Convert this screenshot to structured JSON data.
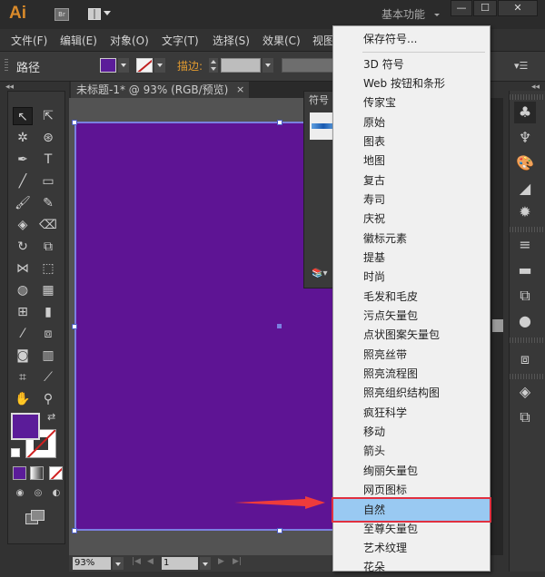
{
  "app": {
    "logo": "Ai",
    "bridge_label": "Br",
    "workspace": "基本功能",
    "window_buttons": {
      "minimize": "—",
      "maximize": "☐",
      "close": "✕"
    }
  },
  "menubar": [
    {
      "label": "文件(F)"
    },
    {
      "label": "编辑(E)"
    },
    {
      "label": "对象(O)"
    },
    {
      "label": "文字(T)"
    },
    {
      "label": "选择(S)"
    },
    {
      "label": "效果(C)"
    },
    {
      "label": "视图"
    }
  ],
  "control_bar": {
    "selection_label": "路径",
    "fill_color": "#5b1c99",
    "stroke_label": "描边:",
    "stroke_weight": "",
    "panel_menu_icon": "▾☰"
  },
  "document": {
    "tab_title": "未标题-1* @ 93% (RGB/预览)",
    "tab_close": "×",
    "artboard_color": "#5e1494",
    "zoom": "93%",
    "page": "1"
  },
  "symbols_panel": {
    "tab_label": "符号",
    "library_button": "lib"
  },
  "dropdown_menu": {
    "items": [
      {
        "label": "保存符号..."
      },
      {
        "label": "3D 符号"
      },
      {
        "label": "Web 按钮和条形"
      },
      {
        "label": "传家宝"
      },
      {
        "label": "原始"
      },
      {
        "label": "图表"
      },
      {
        "label": "地图"
      },
      {
        "label": "复古"
      },
      {
        "label": "寿司"
      },
      {
        "label": "庆祝"
      },
      {
        "label": "徽标元素"
      },
      {
        "label": "提基"
      },
      {
        "label": "时尚"
      },
      {
        "label": "毛发和毛皮"
      },
      {
        "label": "污点矢量包"
      },
      {
        "label": "点状图案矢量包"
      },
      {
        "label": "照亮丝带"
      },
      {
        "label": "照亮流程图"
      },
      {
        "label": "照亮组织结构图"
      },
      {
        "label": "疯狂科学"
      },
      {
        "label": "移动"
      },
      {
        "label": "箭头"
      },
      {
        "label": "绚丽矢量包"
      },
      {
        "label": "网页图标"
      },
      {
        "label": "自然",
        "highlighted": true
      },
      {
        "label": "至尊矢量包"
      },
      {
        "label": "艺术纹理"
      },
      {
        "label": "花朵"
      }
    ],
    "highlight_color": "#99c9f2",
    "annotation_color": "#e03040"
  },
  "colors": {
    "fill": "#5b1c99",
    "stroke": "none"
  }
}
